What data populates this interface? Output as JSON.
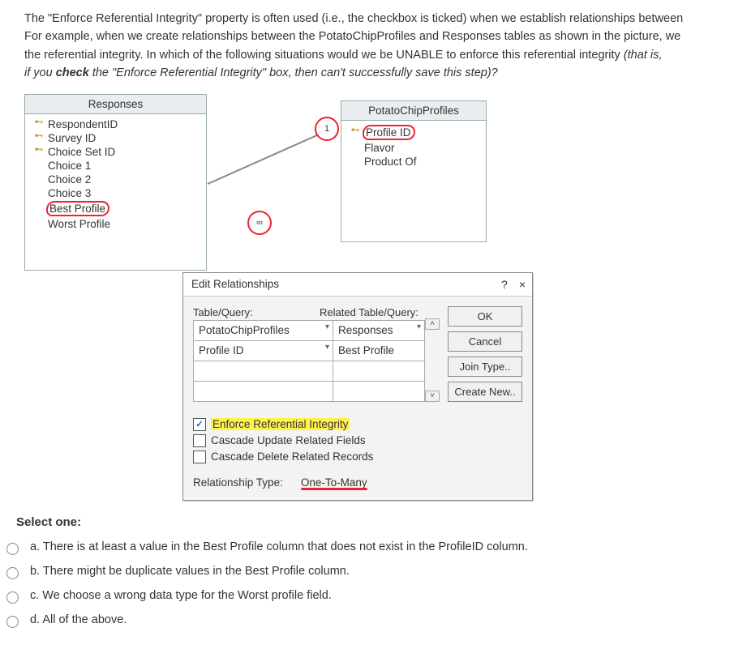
{
  "question": {
    "line1": "The \"Enforce Referential Integrity\" property is often used (i.e., the checkbox is ticked) when we establish relationships between",
    "line2": "For example, when we create relationships between the PotatoChipProfiles and Responses tables as shown in the picture, we",
    "line3": "the referential integrity. In which of the following situations would we be UNABLE to enforce this referential integrity ",
    "line3_italic": "(that is,",
    "line4_italic_pre": "if you ",
    "line4_bold": "check",
    "line4_italic_post": " the \"Enforce Referential Integrity\" box, then can't successfully save this step)?"
  },
  "responses_table": {
    "title": "Responses",
    "rows": [
      {
        "key": true,
        "label": "RespondentID"
      },
      {
        "key": true,
        "label": "Survey ID"
      },
      {
        "key": true,
        "label": "Choice Set ID"
      },
      {
        "key": false,
        "label": "Choice 1"
      },
      {
        "key": false,
        "label": "Choice 2"
      },
      {
        "key": false,
        "label": "Choice 3"
      },
      {
        "key": false,
        "label": "Best Profile",
        "circled": true
      },
      {
        "key": false,
        "label": "Worst Profile"
      }
    ]
  },
  "profiles_table": {
    "title": "PotatoChipProfiles",
    "rows": [
      {
        "key": true,
        "label": "Profile ID",
        "circled": true
      },
      {
        "key": false,
        "label": "Flavor"
      },
      {
        "key": false,
        "label": "Product Of"
      }
    ]
  },
  "rel_ends": {
    "one": "1",
    "many": "∞"
  },
  "dialog": {
    "title": "Edit Relationships",
    "help": "?",
    "close": "×",
    "label_left": "Table/Query:",
    "label_right": "Related Table/Query:",
    "dropdown_left": "PotatoChipProfiles",
    "dropdown_right": "Responses",
    "cell_left": "Profile ID",
    "cell_right": "Best Profile",
    "buttons": {
      "ok": "OK",
      "cancel": "Cancel",
      "join": "Join Type..",
      "create": "Create New.."
    },
    "checks": {
      "enforce": "Enforce Referential Integrity",
      "cascade_update": "Cascade Update Related Fields",
      "cascade_delete": "Cascade Delete Related Records"
    },
    "rel_type_label": "Relationship Type:",
    "rel_type_value": "One-To-Many"
  },
  "select_prompt": "Select one:",
  "options": {
    "a": "a. There is at least a value in the Best Profile column that does not exist in the ProfileID column.",
    "b": "b. There might be duplicate values in the Best Profile column.",
    "c": "c. We choose a wrong data type for the Worst profile field.",
    "d": "d. All of the above."
  }
}
